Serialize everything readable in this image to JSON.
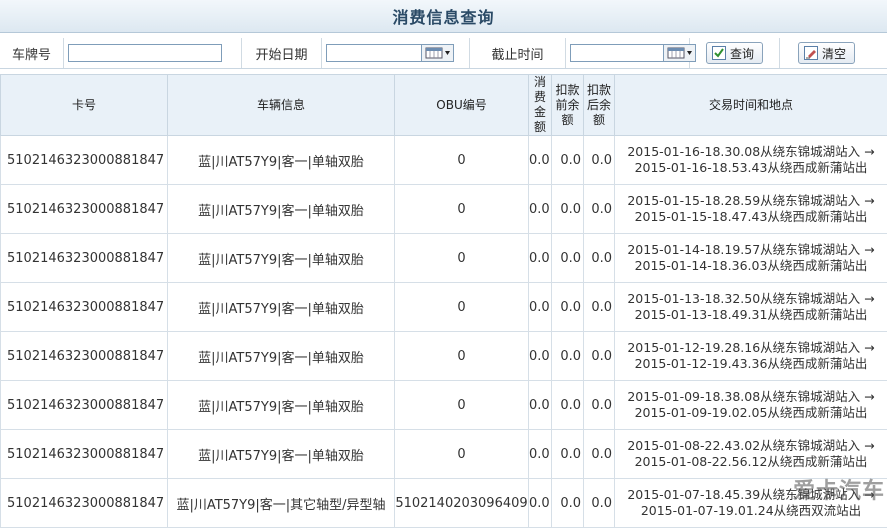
{
  "page_title": "消费信息查询",
  "filters": {
    "plate_label": "车牌号",
    "plate_value": "",
    "start_label": "开始日期",
    "start_value": "",
    "end_label": "截止时间",
    "end_value": "",
    "query_label": "查询",
    "clear_label": "清空"
  },
  "table": {
    "headers": {
      "card": "卡号",
      "vehicle": "车辆信息",
      "obu": "OBU编号",
      "amount": "消费金额",
      "before": "扣款前余额",
      "after": "扣款后余额",
      "trans": "交易时间和地点"
    },
    "rows": [
      {
        "card": "5102146323000881847",
        "vehicle": "蓝|川AT57Y9|客一|单轴双胎",
        "obu": "0",
        "amount": "0.0",
        "before": "0.0",
        "after": "0.0",
        "trans": "2015-01-16-18.30.08从绕东锦城湖站入 → 2015-01-16-18.53.43从绕西成新蒲站出"
      },
      {
        "card": "5102146323000881847",
        "vehicle": "蓝|川AT57Y9|客一|单轴双胎",
        "obu": "0",
        "amount": "0.0",
        "before": "0.0",
        "after": "0.0",
        "trans": "2015-01-15-18.28.59从绕东锦城湖站入 → 2015-01-15-18.47.43从绕西成新蒲站出"
      },
      {
        "card": "5102146323000881847",
        "vehicle": "蓝|川AT57Y9|客一|单轴双胎",
        "obu": "0",
        "amount": "0.0",
        "before": "0.0",
        "after": "0.0",
        "trans": "2015-01-14-18.19.57从绕东锦城湖站入 → 2015-01-14-18.36.03从绕西成新蒲站出"
      },
      {
        "card": "5102146323000881847",
        "vehicle": "蓝|川AT57Y9|客一|单轴双胎",
        "obu": "0",
        "amount": "0.0",
        "before": "0.0",
        "after": "0.0",
        "trans": "2015-01-13-18.32.50从绕东锦城湖站入 → 2015-01-13-18.49.31从绕西成新蒲站出"
      },
      {
        "card": "5102146323000881847",
        "vehicle": "蓝|川AT57Y9|客一|单轴双胎",
        "obu": "0",
        "amount": "0.0",
        "before": "0.0",
        "after": "0.0",
        "trans": "2015-01-12-19.28.16从绕东锦城湖站入 → 2015-01-12-19.43.36从绕西成新蒲站出"
      },
      {
        "card": "5102146323000881847",
        "vehicle": "蓝|川AT57Y9|客一|单轴双胎",
        "obu": "0",
        "amount": "0.0",
        "before": "0.0",
        "after": "0.0",
        "trans": "2015-01-09-18.38.08从绕东锦城湖站入 → 2015-01-09-19.02.05从绕西成新蒲站出"
      },
      {
        "card": "5102146323000881847",
        "vehicle": "蓝|川AT57Y9|客一|单轴双胎",
        "obu": "0",
        "amount": "0.0",
        "before": "0.0",
        "after": "0.0",
        "trans": "2015-01-08-22.43.02从绕东锦城湖站入 → 2015-01-08-22.56.12从绕西成新蒲站出"
      },
      {
        "card": "5102146323000881847",
        "vehicle": "蓝|川AT57Y9|客一|其它轴型/异型轴",
        "obu": "5102140203096409",
        "amount": "0.0",
        "before": "0.0",
        "after": "0.0",
        "trans": "2015-01-07-18.45.39从绕东锦城湖站入 → 2015-01-07-19.01.24从绕西双流站出"
      }
    ]
  },
  "watermark": "爱卡汽车"
}
